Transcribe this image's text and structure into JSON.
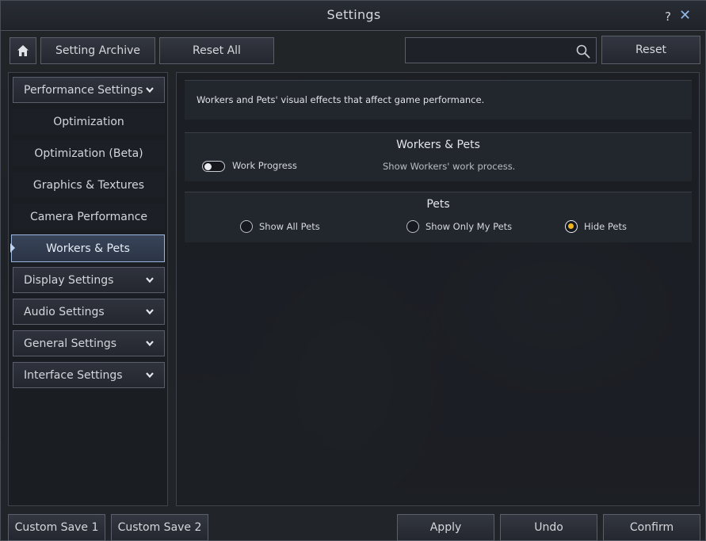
{
  "window": {
    "title": "Settings"
  },
  "titlebar": {
    "help_label": "?",
    "close_label": "✕"
  },
  "toolbar": {
    "home_icon": "home-icon",
    "setting_archive_label": "Setting Archive",
    "reset_all_label": "Reset All",
    "search_value": "",
    "search_placeholder": "",
    "reset_label": "Reset"
  },
  "sidebar": {
    "items": [
      {
        "label": "Performance Settings",
        "type": "category",
        "expanded": true
      },
      {
        "label": "Optimization",
        "type": "sub"
      },
      {
        "label": "Optimization (Beta)",
        "type": "sub"
      },
      {
        "label": "Graphics & Textures",
        "type": "sub"
      },
      {
        "label": "Camera Performance",
        "type": "sub"
      },
      {
        "label": "Workers & Pets",
        "type": "sub",
        "active": true
      },
      {
        "label": "Display Settings",
        "type": "category"
      },
      {
        "label": "Audio Settings",
        "type": "category"
      },
      {
        "label": "General Settings",
        "type": "category"
      },
      {
        "label": "Interface Settings",
        "type": "category"
      }
    ]
  },
  "main": {
    "description": "Workers and Pets' visual effects that affect game performance.",
    "workers_section": {
      "title": "Workers & Pets",
      "toggle_label": "Work Progress",
      "toggle_on": false,
      "toggle_description": "Show Workers' work process."
    },
    "pets_section": {
      "title": "Pets",
      "options": [
        {
          "label": "Show All Pets",
          "checked": false
        },
        {
          "label": "Show Only My Pets",
          "checked": false
        },
        {
          "label": "Hide Pets",
          "checked": true
        }
      ]
    }
  },
  "footer": {
    "custom_save_1_label": "Custom Save 1",
    "custom_save_2_label": "Custom Save 2",
    "apply_label": "Apply",
    "undo_label": "Undo",
    "confirm_label": "Confirm"
  },
  "colors": {
    "accent": "#f2b51c",
    "active_border": "#9ab6dc",
    "close_icon": "#8fb8e8"
  }
}
